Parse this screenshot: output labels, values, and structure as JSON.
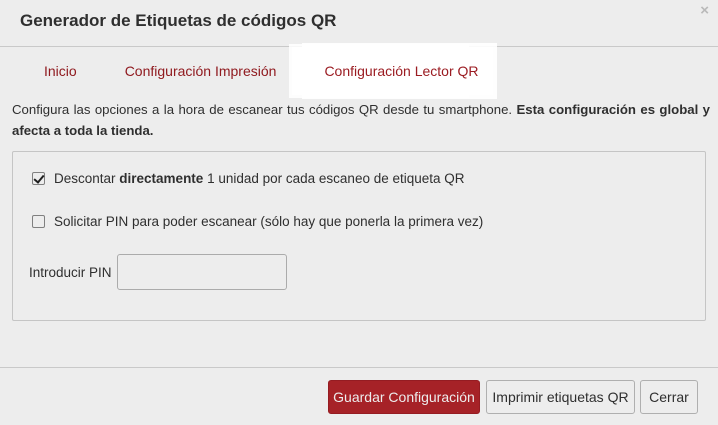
{
  "modal": {
    "title": "Generador de Etiquetas de códigos QR",
    "close_label": "×"
  },
  "tabs": [
    {
      "label": "Inicio",
      "active": false
    },
    {
      "label": "Configuración Impresión",
      "active": false
    },
    {
      "label": "Configuración Lector QR",
      "active": true
    }
  ],
  "description": {
    "text": "Configura las opciones a la hora de escanear tus códigos QR desde tu smartphone. ",
    "bold": "Esta configuración es global y afecta a toda la tienda."
  },
  "form": {
    "discount": {
      "checked": true,
      "pre": "Descontar ",
      "bold": "directamente",
      "post": " 1 unidad por cada escaneo de etiqueta QR"
    },
    "require_pin": {
      "checked": false,
      "label": "Solicitar PIN para poder escanear (sólo hay que ponerla la primera vez)"
    },
    "pin": {
      "label": "Introducir PIN",
      "value": "",
      "placeholder": ""
    }
  },
  "footer": {
    "save_label": "Guardar Configuración",
    "print_label": "Imprimir etiquetas QR",
    "close_label": "Cerrar"
  },
  "colors": {
    "accent": "#b3252b",
    "tab_link": "#9b1c22"
  }
}
